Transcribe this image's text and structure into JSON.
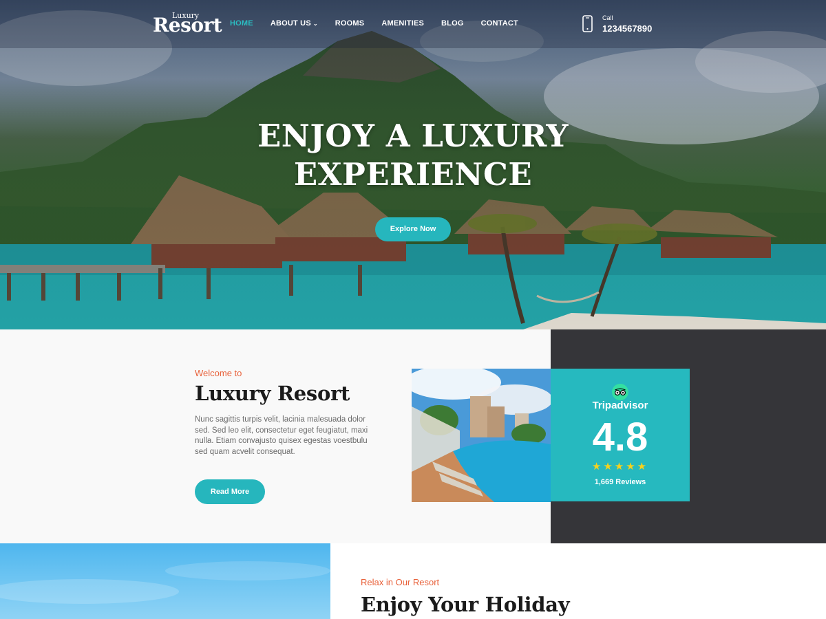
{
  "nav": {
    "logo_small": "Luxury",
    "logo_big": "Resort",
    "items": [
      {
        "label": "HOME",
        "active": true
      },
      {
        "label": "ABOUT US",
        "has_dropdown": true
      },
      {
        "label": "ROOMS"
      },
      {
        "label": "AMENITIES"
      },
      {
        "label": "BLOG"
      },
      {
        "label": "CONTACT"
      }
    ],
    "call_label": "Call",
    "call_number": "1234567890"
  },
  "hero": {
    "title_line1": "ENJOY A LUXURY",
    "title_line2": "EXPERIENCE",
    "button": "Explore Now"
  },
  "welcome": {
    "eyebrow": "Welcome to",
    "title": "Luxury Resort",
    "text": "Nunc sagittis turpis velit, lacinia malesuada dolor sed. Sed leo elit, consectetur eget feugiatut, maxi nulla. Etiam convajusto quisex egestas voestbulu sed quam acvelit consequat.",
    "button": "Read More"
  },
  "tripadvisor": {
    "name": "Tripadvisor",
    "score": "4.8",
    "stars": "★★★★★",
    "reviews": "1,669 Reviews"
  },
  "relax": {
    "eyebrow": "Relax in Our Resort",
    "title": "Enjoy Your Holiday"
  },
  "colors": {
    "accent": "#26b6bd",
    "orange": "#e8613a",
    "dark_panel": "#353539",
    "star": "#f7d21c"
  }
}
